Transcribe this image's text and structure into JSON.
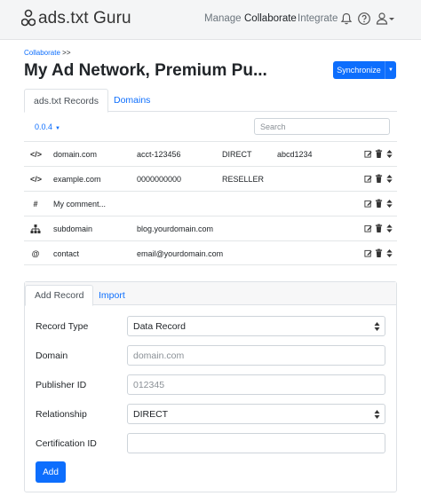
{
  "app": {
    "brand": "ads.txt Guru"
  },
  "nav": {
    "items": [
      "Manage",
      "Collaborate",
      "Integrate"
    ]
  },
  "breadcrumb": {
    "link": "Collaborate",
    "separator": ">>"
  },
  "page": {
    "title": "My Ad Network, Premium Pu..."
  },
  "sync": {
    "label": "Synchronize"
  },
  "tabs": [
    "ads.txt Records",
    "Domains"
  ],
  "version": {
    "label": "0.0.4"
  },
  "search": {
    "placeholder": "Search"
  },
  "records": [
    {
      "icon": "code-icon",
      "domain": "domain.com",
      "publisher": "acct-123456",
      "relationship": "DIRECT",
      "cert": "abcd1234"
    },
    {
      "icon": "code-icon",
      "domain": "example.com",
      "publisher": "0000000000",
      "relationship": "RESELLER",
      "cert": ""
    },
    {
      "icon": "hash-icon",
      "domain": "My comment...",
      "publisher": "",
      "relationship": "",
      "cert": ""
    },
    {
      "icon": "sitemap-icon",
      "domain": "subdomain",
      "publisher": "blog.yourdomain.com",
      "relationship": "",
      "cert": ""
    },
    {
      "icon": "at-icon",
      "domain": "contact",
      "publisher": "email@yourdomain.com",
      "relationship": "",
      "cert": ""
    }
  ],
  "add_form": {
    "tabs": [
      "Add Record",
      "Import"
    ],
    "record_type": {
      "label": "Record Type",
      "value": "Data Record"
    },
    "domain": {
      "label": "Domain",
      "placeholder": "domain.com"
    },
    "publisher_id": {
      "label": "Publisher ID",
      "placeholder": "012345"
    },
    "relationship": {
      "label": "Relationship",
      "value": "DIRECT"
    },
    "certification_id": {
      "label": "Certification ID",
      "placeholder": ""
    },
    "submit_label": "Add"
  },
  "colors": {
    "primary": "#0d6efd",
    "navbar_bg": "#f4f5f6"
  }
}
